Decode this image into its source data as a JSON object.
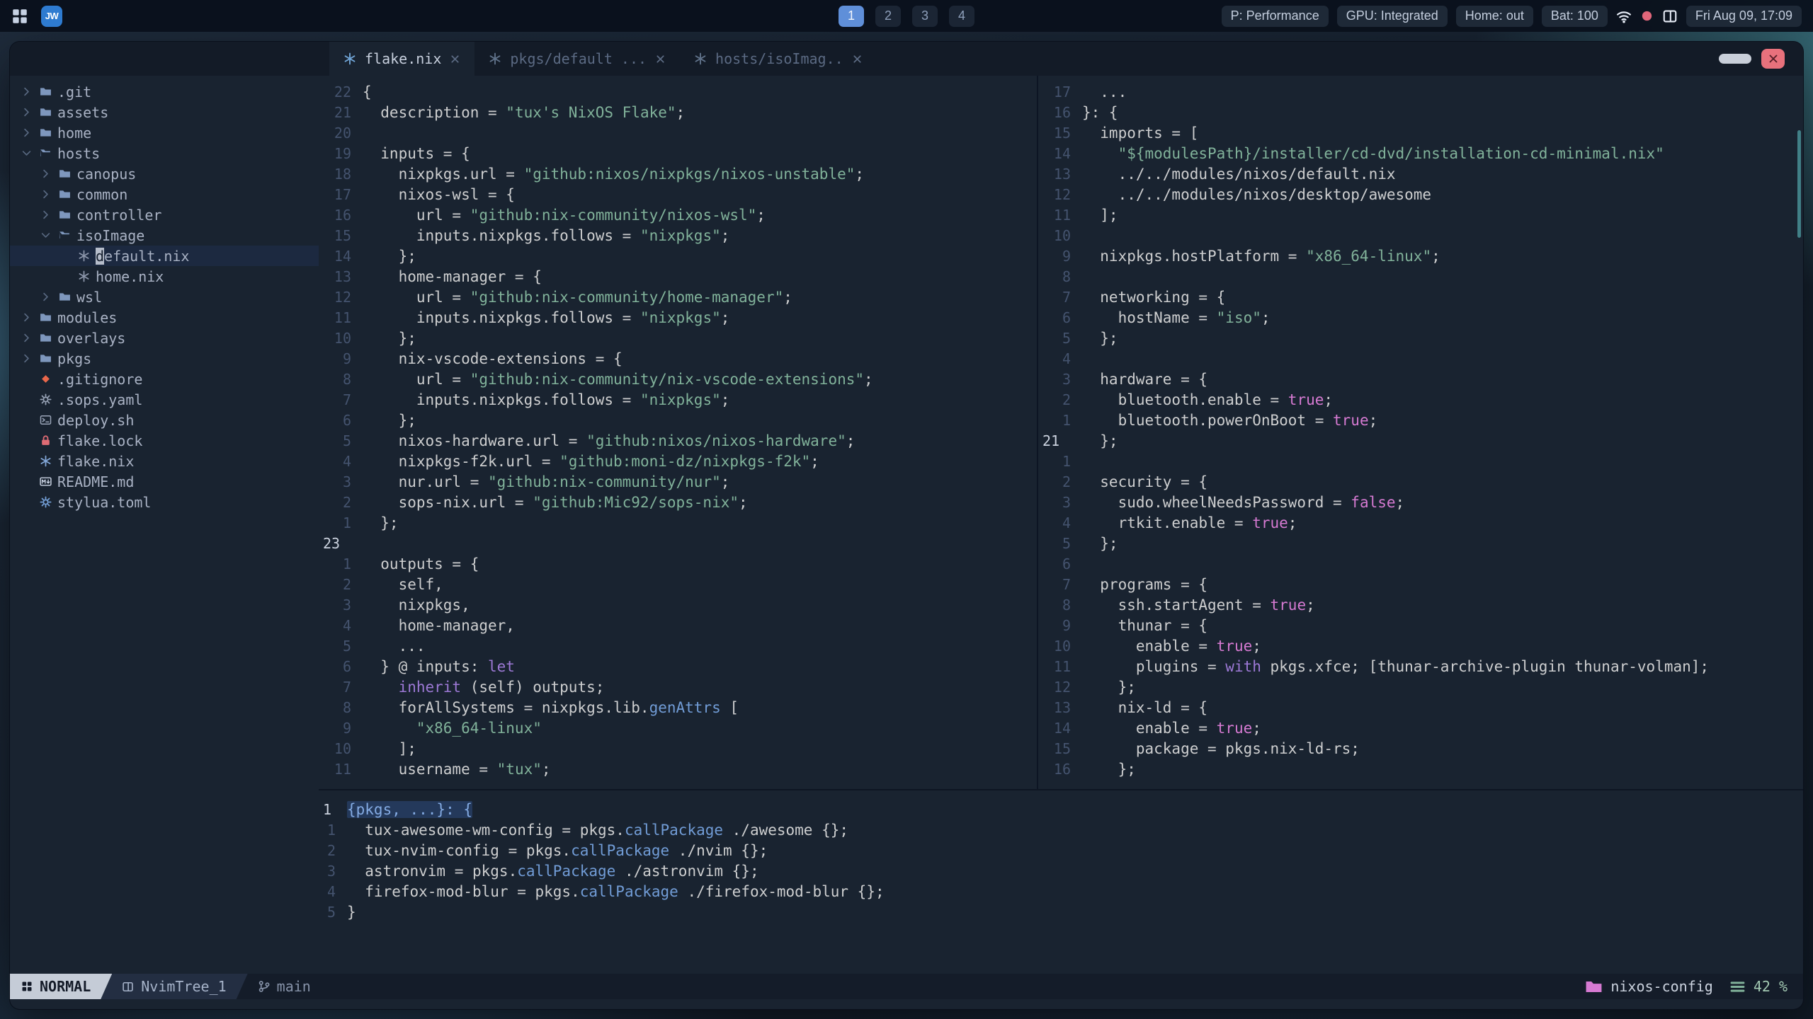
{
  "topbar": {
    "logo": "JW",
    "tags": [
      "1",
      "2",
      "3",
      "4"
    ],
    "status": [
      "P: Performance",
      "GPU: Integrated",
      "Home: out",
      "Bat: 100"
    ],
    "clock": "Fri Aug 09, 17:09"
  },
  "window": {
    "tabs": [
      {
        "label": "flake.nix",
        "active": true
      },
      {
        "label": "pkgs/default ...",
        "active": false
      },
      {
        "label": "hosts/isoImag..",
        "active": false
      }
    ],
    "tree": {
      "items": [
        {
          "label": ".git",
          "icon": "folder",
          "chev": "right",
          "depth": 0,
          "color": "#7e97bd"
        },
        {
          "label": "assets",
          "icon": "folder",
          "chev": "right",
          "depth": 0,
          "color": "#7e97bd"
        },
        {
          "label": "home",
          "icon": "folder",
          "chev": "right",
          "depth": 0,
          "color": "#7e97bd"
        },
        {
          "label": "hosts",
          "icon": "folder-open",
          "chev": "down",
          "depth": 0,
          "color": "#7e97bd"
        },
        {
          "label": "canopus",
          "icon": "folder",
          "chev": "right",
          "depth": 1,
          "color": "#7e97bd"
        },
        {
          "label": "common",
          "icon": "folder",
          "chev": "right",
          "depth": 1,
          "color": "#7e97bd"
        },
        {
          "label": "controller",
          "icon": "folder",
          "chev": "right",
          "depth": 1,
          "color": "#7e97bd"
        },
        {
          "label": "isoImage",
          "icon": "folder-open",
          "chev": "down",
          "depth": 1,
          "color": "#7e97bd"
        },
        {
          "label": "default.nix",
          "icon": "nix",
          "chev": null,
          "depth": 2,
          "color": "#8b95a9",
          "cursor": true
        },
        {
          "label": "home.nix",
          "icon": "nix",
          "chev": null,
          "depth": 2,
          "color": "#8b95a9"
        },
        {
          "label": "wsl",
          "icon": "folder",
          "chev": "right",
          "depth": 1,
          "color": "#7e97bd"
        },
        {
          "label": "modules",
          "icon": "folder",
          "chev": "right",
          "depth": 0,
          "color": "#7e97bd"
        },
        {
          "label": "overlays",
          "icon": "folder",
          "chev": "right",
          "depth": 0,
          "color": "#7e97bd"
        },
        {
          "label": "pkgs",
          "icon": "folder",
          "chev": "right",
          "depth": 0,
          "color": "#7e97bd"
        },
        {
          "label": ".gitignore",
          "icon": "git",
          "chev": null,
          "depth": 0,
          "color": "#e9674b"
        },
        {
          "label": ".sops.yaml",
          "icon": "gear",
          "chev": null,
          "depth": 0,
          "color": "#97a2b5"
        },
        {
          "label": "deploy.sh",
          "icon": "script",
          "chev": null,
          "depth": 0,
          "color": "#9aa5b8"
        },
        {
          "label": "flake.lock",
          "icon": "lock",
          "chev": null,
          "depth": 0,
          "color": "#de6b74"
        },
        {
          "label": "flake.nix",
          "icon": "nix",
          "chev": null,
          "depth": 0,
          "color": "#82a7d8"
        },
        {
          "label": "README.md",
          "icon": "markdown",
          "chev": null,
          "depth": 0,
          "color": "#cbd4e4"
        },
        {
          "label": "stylua.toml",
          "icon": "gear",
          "chev": null,
          "depth": 0,
          "color": "#74a0d8"
        }
      ]
    },
    "panes": {
      "flake": {
        "lines": [
          {
            "n": "22",
            "t": "{"
          },
          {
            "n": "21",
            "t": "  description = \"tux's NixOS Flake\";"
          },
          {
            "n": "20",
            "t": ""
          },
          {
            "n": "19",
            "t": "  inputs = {"
          },
          {
            "n": "18",
            "t": "    nixpkgs.url = \"github:nixos/nixpkgs/nixos-unstable\";"
          },
          {
            "n": "17",
            "t": "    nixos-wsl = {"
          },
          {
            "n": "16",
            "t": "      url = \"github:nix-community/nixos-wsl\";"
          },
          {
            "n": "15",
            "t": "      inputs.nixpkgs.follows = \"nixpkgs\";"
          },
          {
            "n": "14",
            "t": "    };"
          },
          {
            "n": "13",
            "t": "    home-manager = {"
          },
          {
            "n": "12",
            "t": "      url = \"github:nix-community/home-manager\";"
          },
          {
            "n": "11",
            "t": "      inputs.nixpkgs.follows = \"nixpkgs\";"
          },
          {
            "n": "10",
            "t": "    };"
          },
          {
            "n": "9",
            "t": "    nix-vscode-extensions = {"
          },
          {
            "n": "8",
            "t": "      url = \"github:nix-community/nix-vscode-extensions\";"
          },
          {
            "n": "7",
            "t": "      inputs.nixpkgs.follows = \"nixpkgs\";"
          },
          {
            "n": "6",
            "t": "    };"
          },
          {
            "n": "5",
            "t": "    nixos-hardware.url = \"github:nixos/nixos-hardware\";"
          },
          {
            "n": "4",
            "t": "    nixpkgs-f2k.url = \"github:moni-dz/nixpkgs-f2k\";"
          },
          {
            "n": "3",
            "t": "    nur.url = \"github:nix-community/nur\";"
          },
          {
            "n": "2",
            "t": "    sops-nix.url = \"github:Mic92/sops-nix\";"
          },
          {
            "n": "1",
            "t": "  };"
          },
          {
            "n": "23",
            "t": "",
            "cur": true
          },
          {
            "n": "1",
            "t": "  outputs = {"
          },
          {
            "n": "2",
            "t": "    self,"
          },
          {
            "n": "3",
            "t": "    nixpkgs,"
          },
          {
            "n": "4",
            "t": "    home-manager,"
          },
          {
            "n": "5",
            "t": "    ..."
          },
          {
            "n": "6",
            "t": "  } @ inputs: let"
          },
          {
            "n": "7",
            "t": "    inherit (self) outputs;"
          },
          {
            "n": "8",
            "t": "    forAllSystems = nixpkgs.lib.genAttrs ["
          },
          {
            "n": "9",
            "t": "      \"x86_64-linux\""
          },
          {
            "n": "10",
            "t": "    ];"
          },
          {
            "n": "11",
            "t": "    username = \"tux\";"
          }
        ]
      },
      "iso": {
        "lines": [
          {
            "n": "17",
            "t": "  ..."
          },
          {
            "n": "16",
            "t": "}: {"
          },
          {
            "n": "15",
            "t": "  imports = ["
          },
          {
            "n": "14",
            "t": "    \"${modulesPath}/installer/cd-dvd/installation-cd-minimal.nix\""
          },
          {
            "n": "13",
            "t": "    ../../modules/nixos/default.nix"
          },
          {
            "n": "12",
            "t": "    ../../modules/nixos/desktop/awesome"
          },
          {
            "n": "11",
            "t": "  ];"
          },
          {
            "n": "10",
            "t": ""
          },
          {
            "n": "9",
            "t": "  nixpkgs.hostPlatform = \"x86_64-linux\";"
          },
          {
            "n": "8",
            "t": ""
          },
          {
            "n": "7",
            "t": "  networking = {"
          },
          {
            "n": "6",
            "t": "    hostName = \"iso\";"
          },
          {
            "n": "5",
            "t": "  };"
          },
          {
            "n": "4",
            "t": ""
          },
          {
            "n": "3",
            "t": "  hardware = {"
          },
          {
            "n": "2",
            "t": "    bluetooth.enable = true;"
          },
          {
            "n": "1",
            "t": "    bluetooth.powerOnBoot = true;"
          },
          {
            "n": "21",
            "t": "  };",
            "cur": true
          },
          {
            "n": "1",
            "t": ""
          },
          {
            "n": "2",
            "t": "  security = {"
          },
          {
            "n": "3",
            "t": "    sudo.wheelNeedsPassword = false;"
          },
          {
            "n": "4",
            "t": "    rtkit.enable = true;"
          },
          {
            "n": "5",
            "t": "  };"
          },
          {
            "n": "6",
            "t": ""
          },
          {
            "n": "7",
            "t": "  programs = {"
          },
          {
            "n": "8",
            "t": "    ssh.startAgent = true;"
          },
          {
            "n": "9",
            "t": "    thunar = {"
          },
          {
            "n": "10",
            "t": "      enable = true;"
          },
          {
            "n": "11",
            "t": "      plugins = with pkgs.xfce; [thunar-archive-plugin thunar-volman];"
          },
          {
            "n": "12",
            "t": "    };"
          },
          {
            "n": "13",
            "t": "    nix-ld = {"
          },
          {
            "n": "14",
            "t": "      enable = true;"
          },
          {
            "n": "15",
            "t": "      package = pkgs.nix-ld-rs;"
          },
          {
            "n": "16",
            "t": "    };"
          }
        ]
      },
      "pkgs": {
        "lines": [
          {
            "n": "1",
            "t": "{pkgs, ...}: {",
            "cur": true,
            "sel": true
          },
          {
            "n": "1",
            "t": "  tux-awesome-wm-config = pkgs.callPackage ./awesome {};"
          },
          {
            "n": "2",
            "t": "  tux-nvim-config = pkgs.callPackage ./nvim {};"
          },
          {
            "n": "3",
            "t": "  astronvim = pkgs.callPackage ./astronvim {};"
          },
          {
            "n": "4",
            "t": "  firefox-mod-blur = pkgs.callPackage ./firefox-mod-blur {};"
          },
          {
            "n": "5",
            "t": "}"
          }
        ]
      }
    },
    "statusline": {
      "mode": "NORMAL",
      "buffer": "NvimTree_1",
      "branch": "main",
      "project": "nixos-config",
      "progress": "42 %"
    }
  }
}
